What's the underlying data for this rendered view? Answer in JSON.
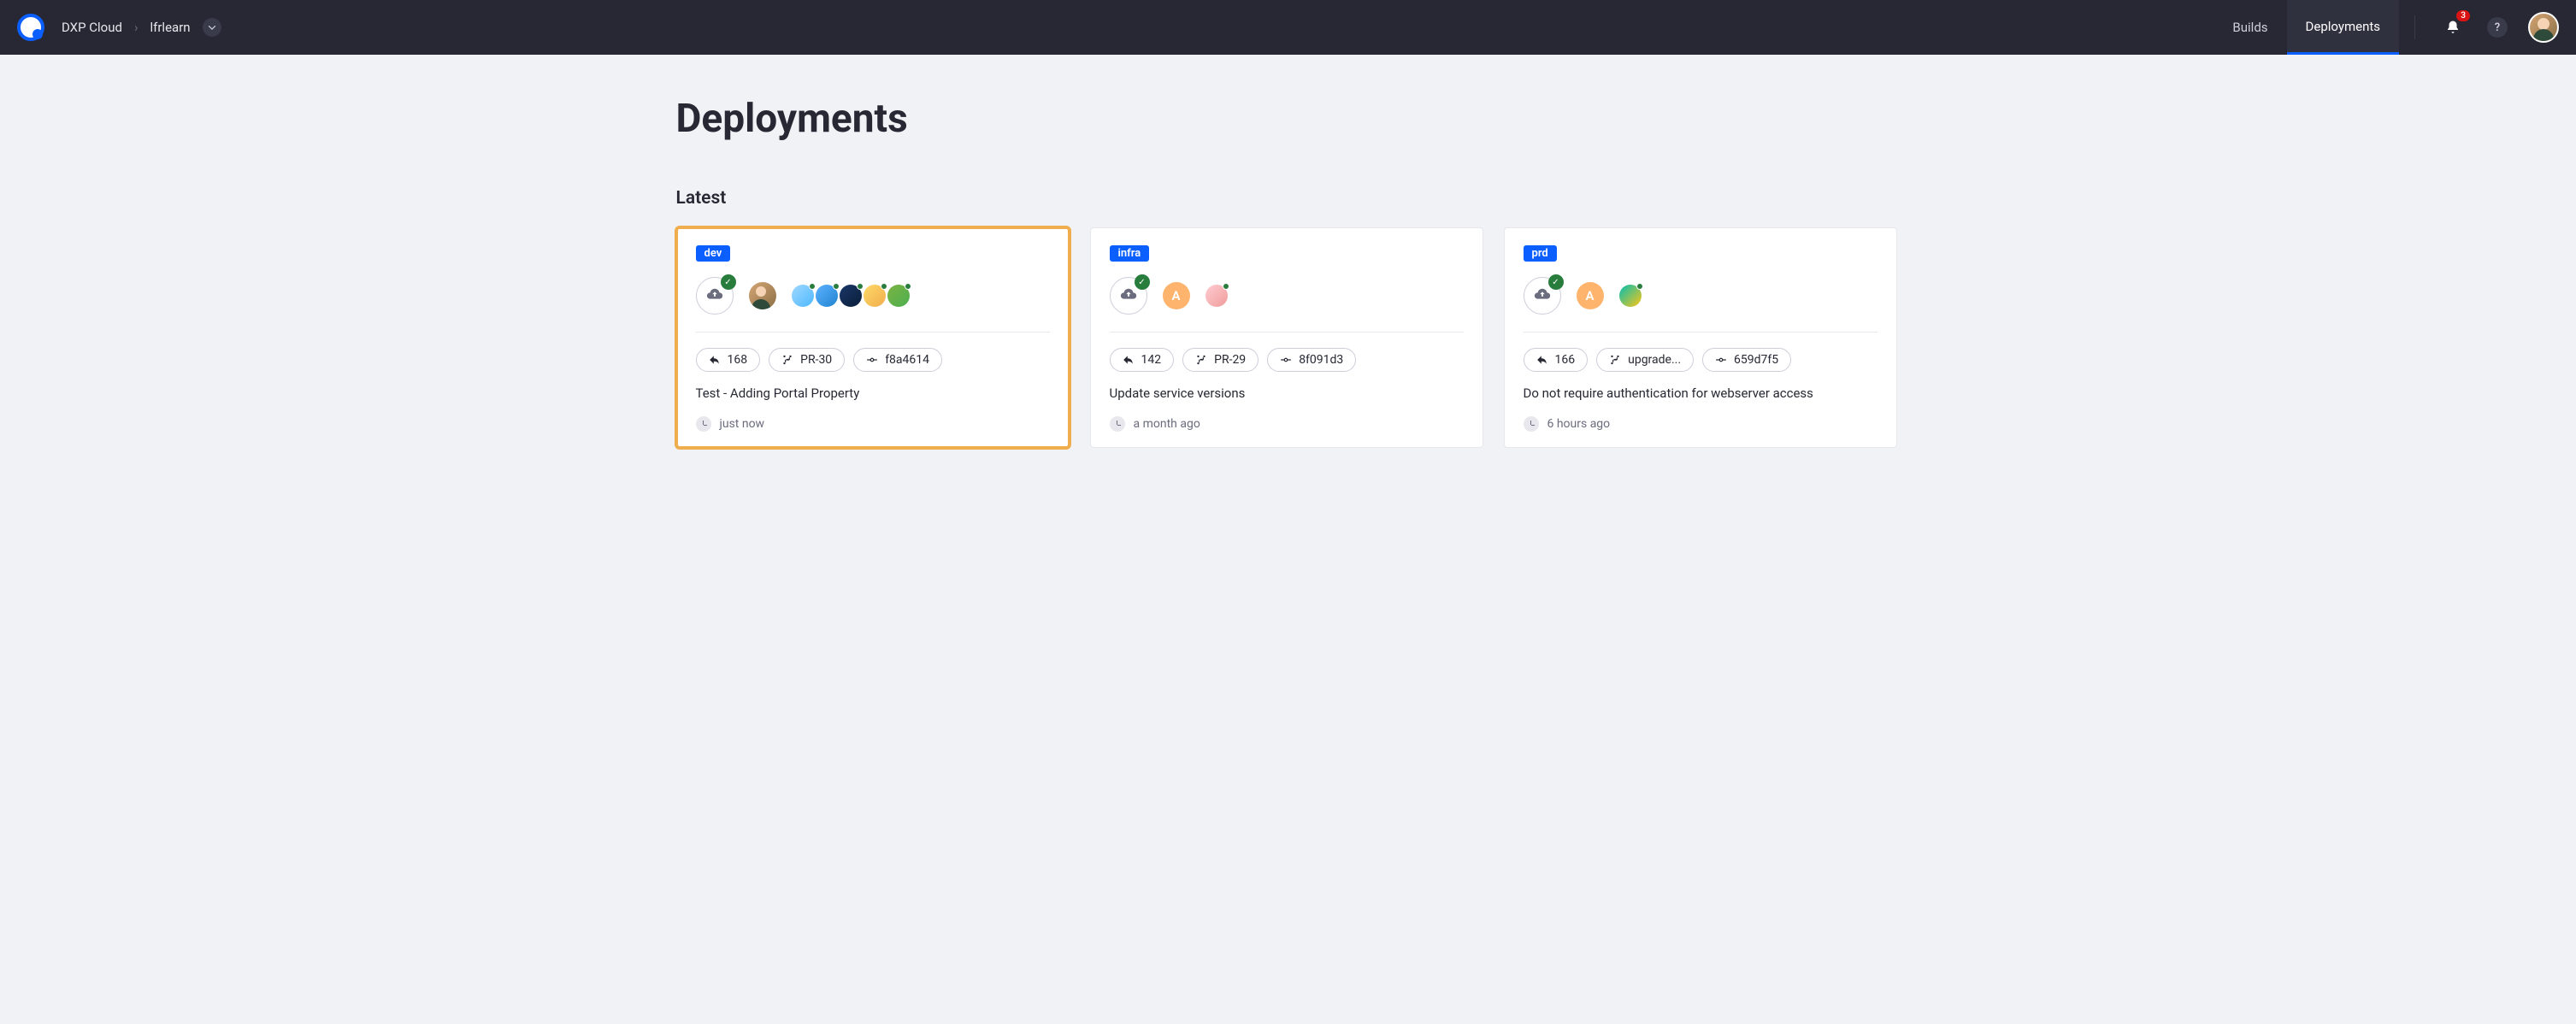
{
  "header": {
    "product": "DXP Cloud",
    "project": "lfrlearn",
    "nav": {
      "builds": "Builds",
      "deployments": "Deployments"
    },
    "notification_count": "3"
  },
  "page": {
    "title": "Deployments",
    "section": "Latest"
  },
  "cards": [
    {
      "env": "dev",
      "build": "168",
      "branch": "PR-30",
      "commit": "f8a4614",
      "title": "Test - Adding Portal Property",
      "time": "just now"
    },
    {
      "env": "infra",
      "build": "142",
      "branch": "PR-29",
      "commit": "8f091d3",
      "title": "Update service versions",
      "time": "a month ago"
    },
    {
      "env": "prd",
      "build": "166",
      "branch": "upgrade...",
      "commit": "659d7f5",
      "title": "Do not require authentication for webserver access",
      "time": "6 hours ago"
    }
  ],
  "avatar_letter": "A"
}
